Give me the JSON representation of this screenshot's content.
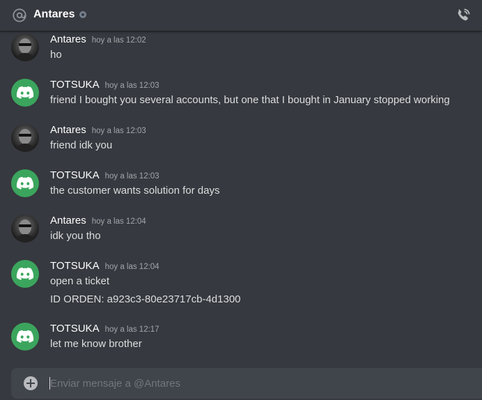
{
  "header": {
    "title": "Antares",
    "at_icon": "at-icon",
    "status_icon": "status-offline-icon",
    "call_icon": "phone-call-icon"
  },
  "colors": {
    "background": "#36393f",
    "composer": "#40444b",
    "discord_green": "#3ba55d",
    "text": "#dcddde",
    "muted": "#a3a6aa"
  },
  "messages": [
    {
      "author": "Antares",
      "avatar": "user-photo-avatar",
      "timestamp": "hoy a las 12:02",
      "lines": [
        "ho"
      ]
    },
    {
      "author": "TOTSUKA",
      "avatar": "discord-logo-avatar",
      "timestamp": "hoy a las 12:03",
      "lines": [
        "friend I bought you several accounts, but one that I bought in January stopped working"
      ]
    },
    {
      "author": "Antares",
      "avatar": "user-photo-avatar",
      "timestamp": "hoy a las 12:03",
      "lines": [
        "friend idk you"
      ]
    },
    {
      "author": "TOTSUKA",
      "avatar": "discord-logo-avatar",
      "timestamp": "hoy a las 12:03",
      "lines": [
        "the customer wants solution for days"
      ]
    },
    {
      "author": "Antares",
      "avatar": "user-photo-avatar",
      "timestamp": "hoy a las 12:04",
      "lines": [
        "idk you tho"
      ]
    },
    {
      "author": "TOTSUKA",
      "avatar": "discord-logo-avatar",
      "timestamp": "hoy a las 12:04",
      "lines": [
        "open a ticket",
        "ID ORDEN: a923c3-80e23717cb-4d1300"
      ]
    },
    {
      "author": "TOTSUKA",
      "avatar": "discord-logo-avatar",
      "timestamp": "hoy a las 12:17",
      "lines": [
        "let me know brother"
      ]
    }
  ],
  "composer": {
    "placeholder": "Enviar mensaje a @Antares",
    "value": "",
    "attach_icon": "plus-circle-icon"
  }
}
